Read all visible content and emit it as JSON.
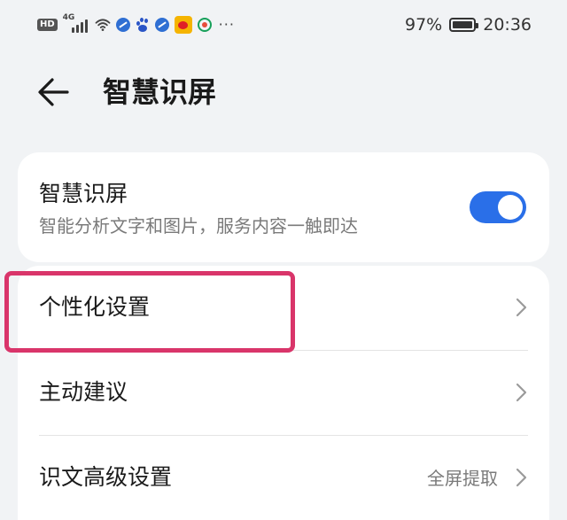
{
  "status_bar": {
    "hd_label": "HD",
    "network_label": "4G",
    "more_label": "···",
    "battery_text": "97%",
    "battery_level": 0.97,
    "time": "20:36",
    "icons": [
      "hd-badge",
      "signal-icon",
      "wifi-icon",
      "app-icon",
      "baidu-icon",
      "app-icon",
      "weibo-icon",
      "app-icon",
      "more-icon",
      "battery-icon"
    ]
  },
  "header": {
    "back_icon": "back-arrow-icon",
    "title": "智慧识屏"
  },
  "main_card": {
    "title": "智慧识屏",
    "subtitle": "智能分析文字和图片，服务内容一触即达",
    "toggle_on": true
  },
  "settings": [
    {
      "label": "个性化设置",
      "value": ""
    },
    {
      "label": "主动建议",
      "value": ""
    },
    {
      "label": "识文高级设置",
      "value": "全屏提取"
    }
  ],
  "colors": {
    "accent": "#2a6fe8",
    "highlight": "#d9356a",
    "background": "#f1f3f5",
    "card": "#ffffff"
  }
}
